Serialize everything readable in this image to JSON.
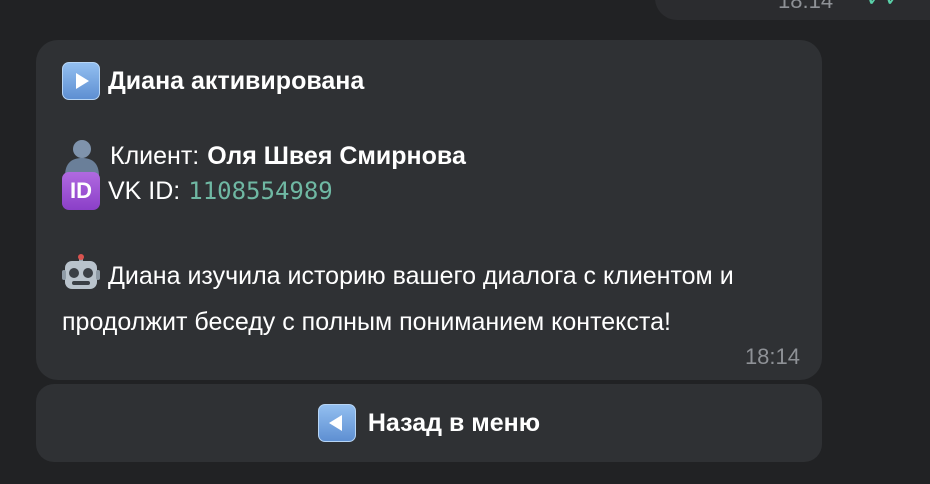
{
  "previous_message": {
    "time": "18:14",
    "status_icon": "double-check-icon",
    "status_glyph": "✓✓"
  },
  "message": {
    "title_icon": "play-button-icon",
    "title": "Диана активирована",
    "client_icon": "bust-silhouette-icon",
    "client_label": "Клиент:",
    "client_name": "Оля Швея Смирнова",
    "id_icon": "id-button-icon",
    "id_icon_text": "ID",
    "vk_label": "VK ID:",
    "vk_id": "1108554989",
    "robot_icon": "robot-face-icon",
    "body": "Диана изучила историю вашего диалога с клиентом и продолжит беседу с полным пониманием контекста!",
    "time": "18:14"
  },
  "keyboard": {
    "back_icon": "reverse-button-icon",
    "back_label": "Назад в меню"
  },
  "colors": {
    "background": "#212224",
    "bubble": "#2f3134",
    "id_link": "#6fb8a3",
    "timestamp": "#8e9196"
  }
}
